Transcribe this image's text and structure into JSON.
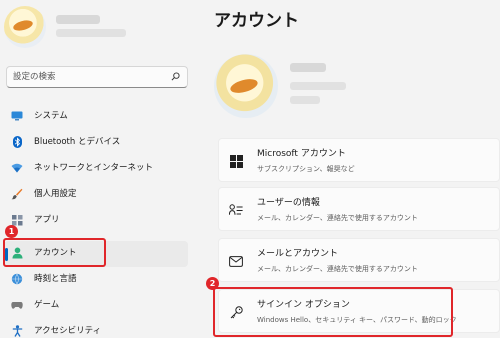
{
  "sidebar": {
    "search": {
      "placeholder": "設定の検索",
      "icon": "search-icon"
    },
    "items": [
      {
        "label": "システム",
        "icon": "monitor-icon"
      },
      {
        "label": "Bluetooth とデバイス",
        "icon": "bluetooth-icon"
      },
      {
        "label": "ネットワークとインターネット",
        "icon": "wifi-icon"
      },
      {
        "label": "個人用設定",
        "icon": "brush-icon"
      },
      {
        "label": "アプリ",
        "icon": "apps-icon"
      },
      {
        "label": "アカウント",
        "icon": "person-icon",
        "selected": true
      },
      {
        "label": "時刻と言語",
        "icon": "globe-clock-icon"
      },
      {
        "label": "ゲーム",
        "icon": "gamepad-icon"
      },
      {
        "label": "アクセシビリティ",
        "icon": "accessibility-icon"
      }
    ]
  },
  "main": {
    "title": "アカウント",
    "cards": [
      {
        "title": "Microsoft アカウント",
        "subtitle": "サブスクリプション、報奨など",
        "icon": "windows-logo-icon"
      },
      {
        "title": "ユーザーの情報",
        "subtitle": "メール、カレンダー、連絡先で使用するアカウント",
        "icon": "user-info-icon"
      },
      {
        "title": "メールとアカウント",
        "subtitle": "メール、カレンダー、連絡先で使用するアカウント",
        "icon": "mail-icon"
      },
      {
        "title": "サインイン オプション",
        "subtitle": "Windows Hello、セキュリティ キー、パスワード、動的ロック",
        "icon": "key-icon"
      }
    ]
  },
  "annotations": {
    "badge1": "1",
    "badge2": "2",
    "color": "#e0262a"
  },
  "colors": {
    "accent": "#0067c0",
    "background": "#f3f3f3",
    "card": "#fbfbfb"
  }
}
